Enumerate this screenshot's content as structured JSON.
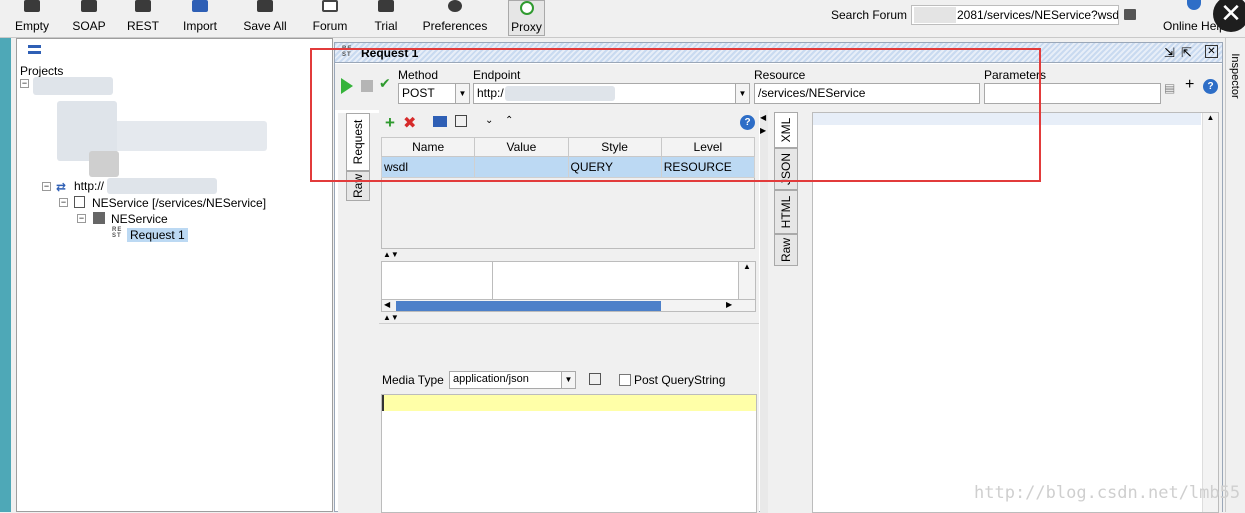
{
  "toolbar": {
    "items": [
      "Empty",
      "SOAP",
      "REST",
      "Import",
      "Save All",
      "Forum",
      "Trial",
      "Preferences",
      "Proxy"
    ],
    "search_label": "Search Forum",
    "search_value": "2081/services/NEService?wsdl",
    "online_help": "Online Help"
  },
  "navigator": {
    "projects_label": "Projects",
    "http_node": "http://",
    "service_node": "NEService [/services/NEService]",
    "resource_node": "NEService",
    "request_node": "Request 1"
  },
  "request": {
    "title": "Request 1",
    "method_label": "Method",
    "method_value": "POST",
    "endpoint_label": "Endpoint",
    "endpoint_value": "http:/",
    "resource_label": "Resource",
    "resource_value": "/services/NEService",
    "parameters_label": "Parameters",
    "parameters_value": "",
    "left_tabs": [
      "Request",
      "Raw"
    ],
    "params_headers": [
      "Name",
      "Value",
      "Style",
      "Level"
    ],
    "params_rows": [
      [
        "wsdl",
        "",
        "QUERY",
        "RESOURCE"
      ]
    ],
    "media_type_label": "Media Type",
    "media_type_value": "application/json",
    "post_querystring_label": "Post QueryString"
  },
  "response": {
    "tabs": [
      "XML",
      "JSON",
      "HTML",
      "Raw"
    ]
  },
  "inspector_label": "Inspector",
  "watermark": "http://blog.csdn.net/lmb55",
  "colors": {
    "highlight": "#e23b3b",
    "selection": "#bcd9f3",
    "text_area": "#ffffa8"
  }
}
